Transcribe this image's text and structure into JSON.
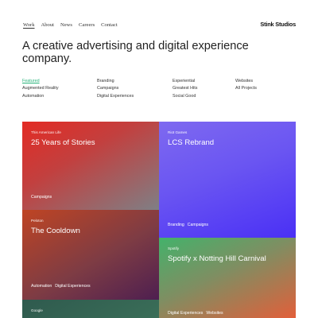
{
  "nav": {
    "items": [
      "Work",
      "About",
      "News",
      "Careers",
      "Contact"
    ],
    "brand": "Stink Studios"
  },
  "headline": "A creative advertising and digital experience company.",
  "filters": {
    "col1": [
      "Featured",
      "Augmented Reality",
      "Automation"
    ],
    "col2": [
      "Branding",
      "Campaigns",
      "Digital Experiences"
    ],
    "col3": [
      "Experiential",
      "Greatest Hits",
      "Social Good"
    ],
    "col4": [
      "Websites",
      "All Projects"
    ]
  },
  "cards": [
    {
      "client": "This American Life",
      "title": "25 Years of Stories",
      "tags": [
        "Campaigns"
      ]
    },
    {
      "client": "Riot Games",
      "title": "LCS Rebrand",
      "tags": [
        "Branding",
        "Campaigns"
      ]
    },
    {
      "client": "Peloton",
      "title": "The Cooldown",
      "tags": [
        "Automation",
        "Digital Experiences"
      ]
    },
    {
      "client": "Spotify",
      "title": "Spotify x Notting Hill Carnival",
      "tags": [
        "Digital Experiences",
        "Websites"
      ]
    },
    {
      "client": "Google",
      "title": "",
      "tags": []
    }
  ],
  "colors": {
    "accent": "#27b27a"
  }
}
